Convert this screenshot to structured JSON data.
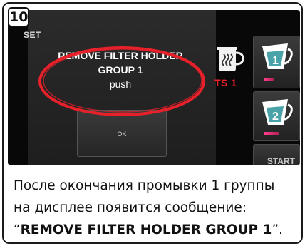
{
  "step_number": "10",
  "display": {
    "set_label": "SET",
    "message_line1": "REMOVE FILTER HOLDER",
    "message_line2": "GROUP 1",
    "message_action": "push",
    "ok_label": "OK",
    "ts_label": "TS 1",
    "cup1_number": "1",
    "cup2_number": "2",
    "start_label": "START",
    "cup1_progress": 0.35,
    "cup2_progress": 0.55,
    "highlight_color": "#e8202a",
    "accent_color": "#ff3f8a"
  },
  "icons": [
    "steam-icon",
    "cup-icon"
  ],
  "caption": {
    "line1": "После окончания промывки 1 группы",
    "line2": "на дисплее появится сообщение:",
    "quote_open": "“",
    "quote_bold": "REMOVE FILTER HOLDER GROUP 1",
    "quote_close": "”."
  }
}
